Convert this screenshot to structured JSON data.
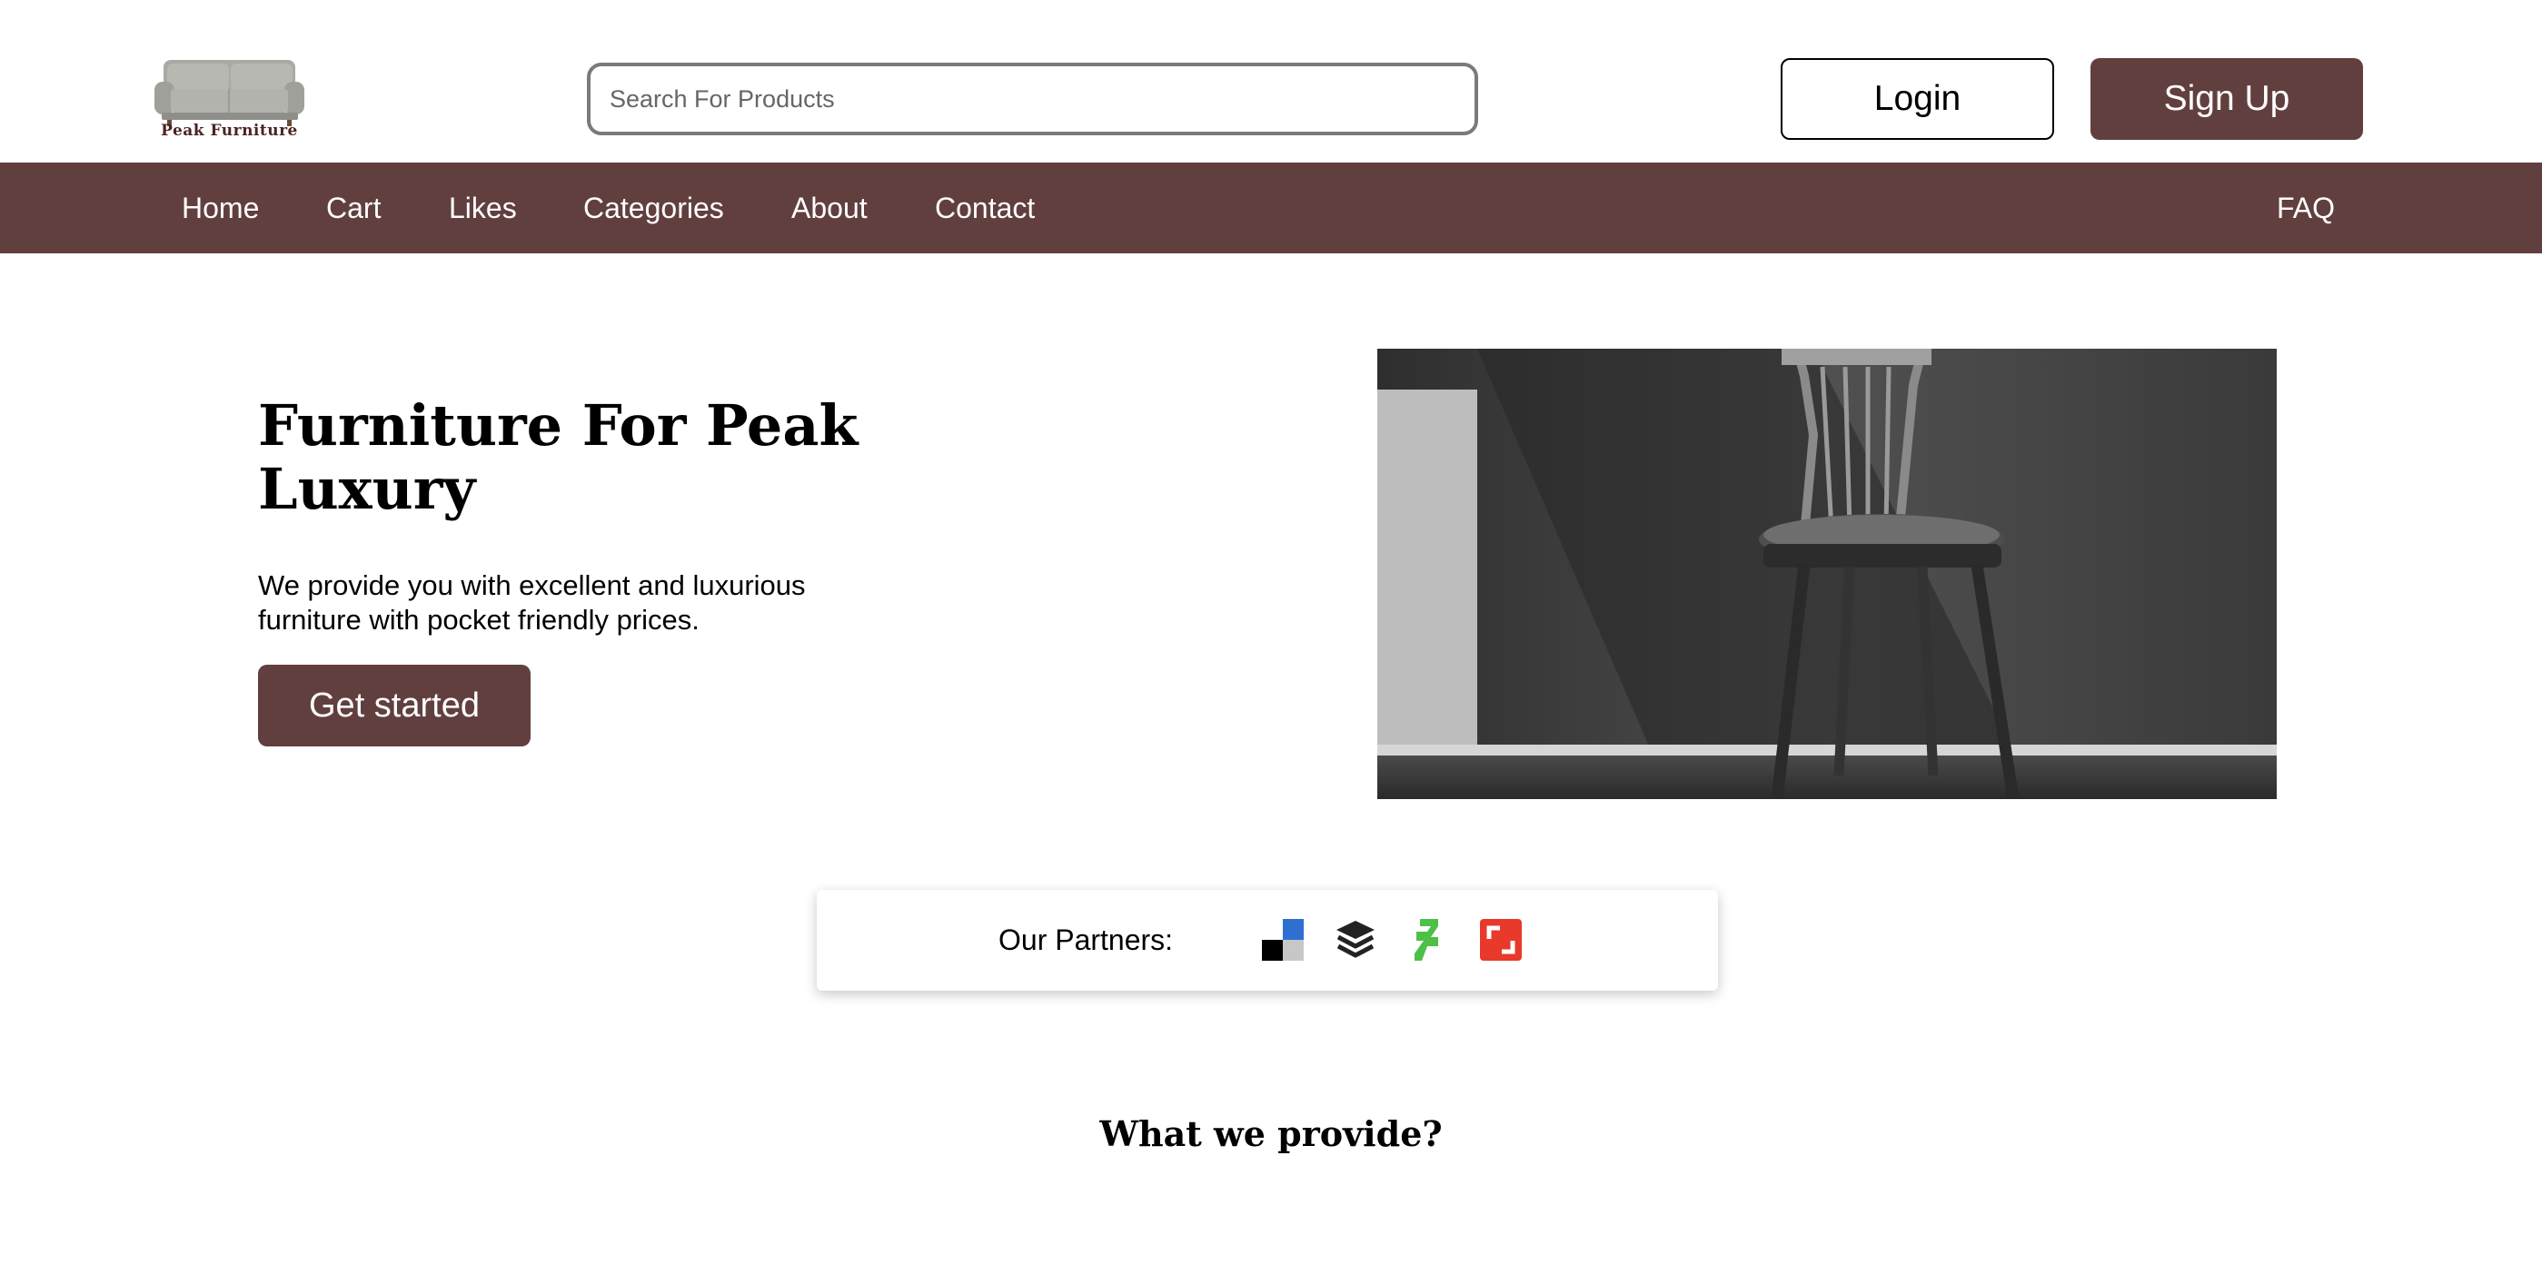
{
  "brand": {
    "name": "Peak Furniture",
    "logo_icon": "sofa-icon",
    "accent_color": "#623f3f"
  },
  "search": {
    "placeholder": "Search For Products",
    "value": ""
  },
  "auth": {
    "login_label": "Login",
    "signup_label": "Sign Up"
  },
  "nav": {
    "items": [
      {
        "label": "Home"
      },
      {
        "label": "Cart"
      },
      {
        "label": "Likes"
      },
      {
        "label": "Categories"
      },
      {
        "label": "About"
      },
      {
        "label": "Contact"
      }
    ],
    "faq_label": "FAQ"
  },
  "hero": {
    "title": "Furniture For Peak Luxury",
    "subtitle": "We provide you with excellent and luxurious furniture with pocket friendly prices.",
    "cta_label": "Get started",
    "image_icon": "chair-photo"
  },
  "partners": {
    "label": "Our Partners:",
    "icons": [
      "delicious-icon",
      "buffer-icon",
      "deviantart-icon",
      "screenpal-icon"
    ]
  },
  "section": {
    "title": "What we provide?"
  }
}
